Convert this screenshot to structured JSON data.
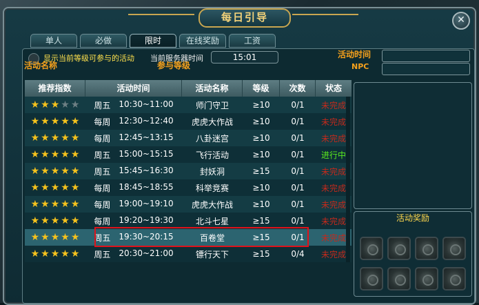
{
  "window": {
    "title": "每日引导",
    "close_symbol": "✕"
  },
  "tabs": [
    {
      "label": "单人",
      "active": false
    },
    {
      "label": "必做",
      "active": false
    },
    {
      "label": "限时",
      "active": true
    },
    {
      "label": "在线奖励",
      "active": false
    },
    {
      "label": "工资",
      "active": false
    }
  ],
  "filter": {
    "checkbox_label": "显示当前等级可参与的活动",
    "checked": false
  },
  "server": {
    "label": "当前服务器时间",
    "time": "15:01"
  },
  "labels": {
    "activity_name": "活动名称",
    "level_required": "参与等级",
    "activity_time": "活动时间",
    "npc": "NPC",
    "reward": "活动奖励"
  },
  "table": {
    "columns": [
      "推荐指数",
      "活动时间",
      "活动名称",
      "等级",
      "次数",
      "状态"
    ],
    "rows": [
      {
        "stars": 3,
        "day": "周五",
        "time": "10:30~11:00",
        "name": "师门守卫",
        "level": "≥10",
        "count": "0/1",
        "status": "未完成",
        "status_type": "red"
      },
      {
        "stars": 5,
        "day": "每周",
        "time": "12:30~12:40",
        "name": "虎虎大作战",
        "level": "≥10",
        "count": "0/1",
        "status": "未完成",
        "status_type": "red"
      },
      {
        "stars": 5,
        "day": "每周",
        "time": "12:45~13:15",
        "name": "八卦迷宫",
        "level": "≥10",
        "count": "0/1",
        "status": "未完成",
        "status_type": "red"
      },
      {
        "stars": 5,
        "day": "周五",
        "time": "15:00~15:15",
        "name": "飞行活动",
        "level": "≥10",
        "count": "0/1",
        "status": "进行中",
        "status_type": "green"
      },
      {
        "stars": 5,
        "day": "周五",
        "time": "15:45~16:30",
        "name": "封妖洞",
        "level": "≥15",
        "count": "0/1",
        "status": "未完成",
        "status_type": "red"
      },
      {
        "stars": 5,
        "day": "每周",
        "time": "18:45~18:55",
        "name": "科举竞赛",
        "level": "≥10",
        "count": "0/1",
        "status": "未完成",
        "status_type": "red"
      },
      {
        "stars": 5,
        "day": "每周",
        "time": "19:00~19:10",
        "name": "虎虎大作战",
        "level": "≥10",
        "count": "0/1",
        "status": "未完成",
        "status_type": "red"
      },
      {
        "stars": 5,
        "day": "每周",
        "time": "19:20~19:30",
        "name": "北斗七星",
        "level": "≥15",
        "count": "0/1",
        "status": "未完成",
        "status_type": "red"
      },
      {
        "stars": 5,
        "day": "周五",
        "time": "19:30~20:15",
        "name": "百卷堂",
        "level": "≥15",
        "count": "0/1",
        "status": "未完成",
        "status_type": "red",
        "selected": true
      },
      {
        "stars": 5,
        "day": "周五",
        "time": "20:30~21:00",
        "name": "镖行天下",
        "level": "≥15",
        "count": "0/4",
        "status": "未完成",
        "status_type": "red"
      }
    ]
  },
  "reward_slots": 8,
  "colors": {
    "accent_gold": "#f4d37a",
    "status_red": "#c32a1c",
    "status_green": "#5bea1d",
    "label_orange": "#f6a11c",
    "highlight_red": "#e0121a"
  }
}
